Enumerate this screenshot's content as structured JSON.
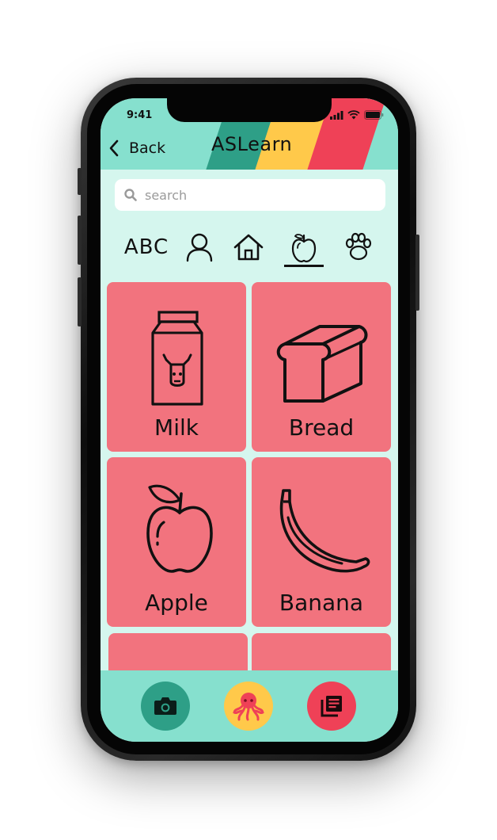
{
  "status_bar": {
    "time": "9:41"
  },
  "header": {
    "back_label": "Back",
    "title": "ASLearn"
  },
  "search": {
    "placeholder": "search"
  },
  "categories": [
    {
      "label": "ABC",
      "icon": "abc-text"
    },
    {
      "label": "",
      "icon": "person-icon"
    },
    {
      "label": "",
      "icon": "home-icon"
    },
    {
      "label": "",
      "icon": "apple-icon",
      "selected": true
    },
    {
      "label": "",
      "icon": "paw-icon"
    }
  ],
  "cards": [
    {
      "label": "Milk",
      "icon": "milk-carton-icon"
    },
    {
      "label": "Bread",
      "icon": "bread-icon"
    },
    {
      "label": "Apple",
      "icon": "apple-icon"
    },
    {
      "label": "Banana",
      "icon": "banana-icon"
    }
  ],
  "bottom_nav": [
    {
      "name": "camera",
      "icon": "camera-icon",
      "color": "#2e9f87"
    },
    {
      "name": "octopus",
      "icon": "octopus-icon",
      "color": "#ffc94a"
    },
    {
      "name": "library",
      "icon": "library-icon",
      "color": "#ef4157"
    }
  ],
  "colors": {
    "header": "#86e0ce",
    "background": "#d5f6ee",
    "card": "#f2737e"
  }
}
